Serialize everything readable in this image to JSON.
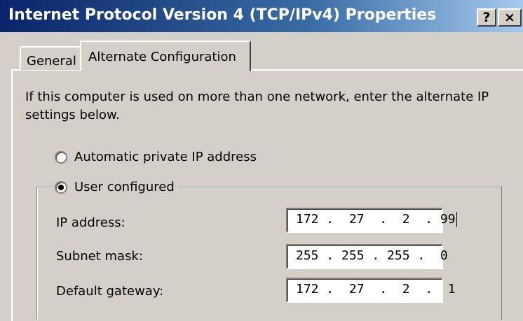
{
  "window": {
    "title": "Internet Protocol Version 4 (TCP/IPv4) Properties",
    "help_button": "?",
    "close_button": "×"
  },
  "tabs": [
    {
      "label": "General",
      "selected": false
    },
    {
      "label": "Alternate Configuration",
      "selected": true
    }
  ],
  "intro_text": "If this computer is used on more than one network, enter the alternate IP settings below.",
  "options": {
    "automatic": {
      "label": "Automatic private IP address",
      "selected": false
    },
    "user": {
      "label": "User configured",
      "selected": true
    }
  },
  "fields": {
    "ip_address": {
      "label": "IP address:",
      "value": "172 .  27  .  2  . 99"
    },
    "subnet_mask": {
      "label": "Subnet mask:",
      "value": "255 . 255 . 255 .  0"
    },
    "default_gateway": {
      "label": "Default gateway:",
      "value": "172 .  27  .  2  .  1"
    }
  },
  "colors": {
    "dialog_bg": "#d4d0c8",
    "titlebar_start": "#0a246a",
    "titlebar_end": "#a6caf0"
  }
}
